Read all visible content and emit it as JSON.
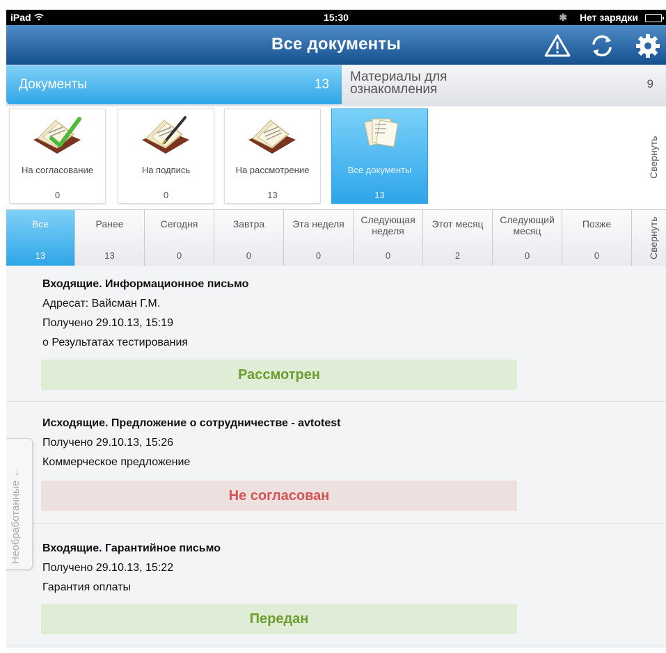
{
  "status_bar": {
    "device": "iPad",
    "time": "15:30",
    "battery_text": "Нет зарядки"
  },
  "header": {
    "title": "Все документы"
  },
  "top_tabs": [
    {
      "label": "Документы",
      "count": "13"
    },
    {
      "label": "Материалы для ознакомления",
      "count": "9"
    }
  ],
  "categories": [
    {
      "label": "На согласование",
      "count": "0"
    },
    {
      "label": "На подпись",
      "count": "0"
    },
    {
      "label": "На рассмотрение",
      "count": "13"
    },
    {
      "label": "Все документы",
      "count": "13"
    }
  ],
  "collapse_label": "Свернуть",
  "periods": [
    {
      "label": "Все",
      "count": "13"
    },
    {
      "label": "Ранее",
      "count": "13"
    },
    {
      "label": "Сегодня",
      "count": "0"
    },
    {
      "label": "Завтра",
      "count": "0"
    },
    {
      "label": "Эта неделя",
      "count": "0"
    },
    {
      "label": "Следующая неделя",
      "count": "0"
    },
    {
      "label": "Этот месяц",
      "count": "2"
    },
    {
      "label": "Следующий месяц",
      "count": "0"
    },
    {
      "label": "Позже",
      "count": "0"
    }
  ],
  "documents": [
    {
      "title": "Входящие. Информационное письмо",
      "addressee": "Адресат: Вайсман Г.М.",
      "received": "Получено 29.10.13, 15:19",
      "subject": "о Результатах тестирования",
      "status": "Рассмотрен"
    },
    {
      "title": "Исходящие. Предложение о сотрудничестве - avtotest",
      "received": "Получено 29.10.13, 15:26",
      "subject": "Коммерческое предложение",
      "status": "Не согласован"
    },
    {
      "title": "Входящие. Гарантийное письмо",
      "received": "Получено 29.10.13, 15:22",
      "subject": "Гарантия оплаты",
      "status": "Передан"
    }
  ],
  "side_tab": {
    "label": "Необработанные"
  },
  "colors": {
    "accent": "#2fa6e8",
    "header": "#16508f",
    "status_ok": "#6c9d2e",
    "status_bad": "#d15454"
  }
}
